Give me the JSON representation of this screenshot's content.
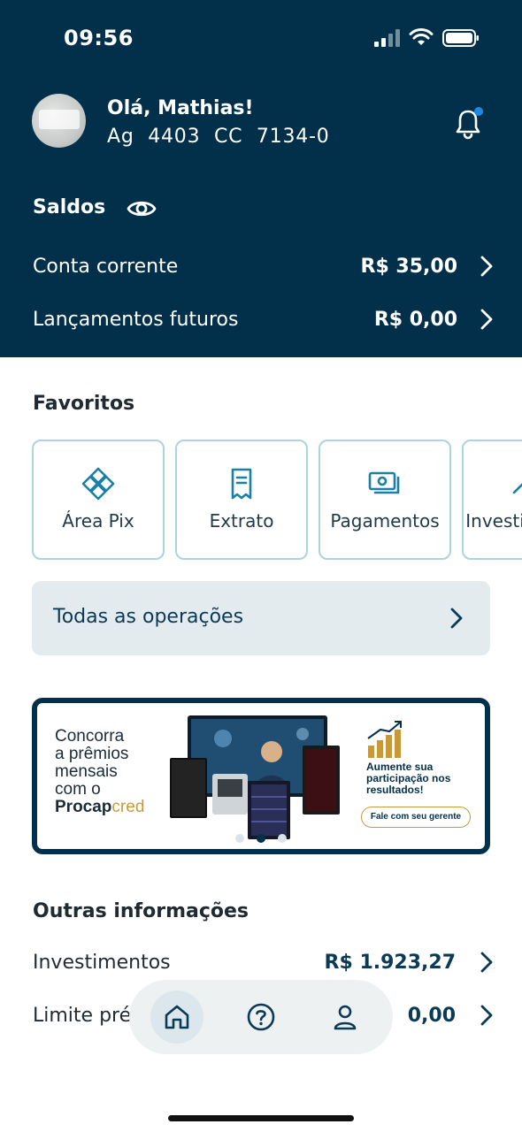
{
  "status_bar": {
    "time": "09:56"
  },
  "header": {
    "greeting": "Olá, Mathias!",
    "account": "Ag  4403  CC  7134-0"
  },
  "balances": {
    "title": "Saldos",
    "rows": [
      {
        "label": "Conta corrente",
        "value": "R$ 35,00"
      },
      {
        "label": "Lançamentos futuros",
        "value": "R$ 0,00"
      }
    ]
  },
  "favorites": {
    "title": "Favoritos",
    "items": [
      {
        "label": "Área Pix",
        "icon": "pix-icon"
      },
      {
        "label": "Extrato",
        "icon": "receipt-icon"
      },
      {
        "label": "Pagamentos",
        "icon": "payments-icon"
      },
      {
        "label": "Investimentos",
        "icon": "investments-icon"
      }
    ]
  },
  "all_operations": {
    "label": "Todas as operações"
  },
  "banner": {
    "line1": "Concorra",
    "line2": "a prêmios",
    "line3": "mensais",
    "line4": "com o",
    "brand_bold": "Procap",
    "brand_light": "cred",
    "side_text": "Aumente sua participação nos resultados!",
    "cta": "Fale com seu gerente",
    "slide_count": 3,
    "active_slide": 2
  },
  "other_info": {
    "title": "Outras informações",
    "rows": [
      {
        "label": "Investimentos",
        "value": "R$ 1.923,27"
      },
      {
        "label": "Limite pré",
        "value": "0,00"
      }
    ]
  },
  "bottom_nav": {
    "items": [
      {
        "icon": "home-icon",
        "active": true
      },
      {
        "icon": "help-icon",
        "active": false
      },
      {
        "icon": "profile-icon",
        "active": false
      }
    ]
  },
  "colors": {
    "header_bg": "#02304a",
    "card_border": "#a9d4e0",
    "accent_gold": "#c69a3a",
    "notification_dot": "#1e88e5"
  }
}
